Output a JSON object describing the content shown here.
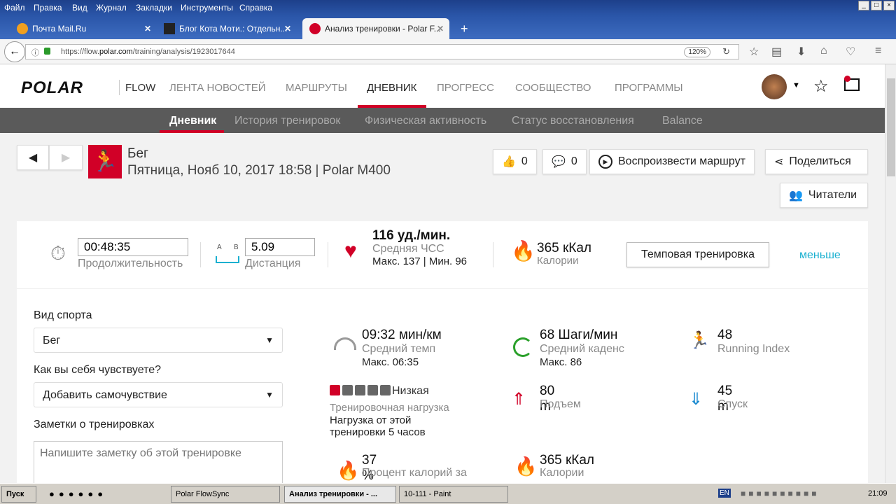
{
  "browser": {
    "menu": [
      "Файл",
      "Правка",
      "Вид",
      "Журнал",
      "Закладки",
      "Инструменты",
      "Справка"
    ],
    "tabs": [
      {
        "title": "Почта Mail.Ru"
      },
      {
        "title": "Блог Кота Моти.: Отдельн..."
      },
      {
        "title": "Анализ тренировки - Polar F..."
      }
    ],
    "url_prefix": "https://flow.",
    "url_domain": "polar.com",
    "url_path": "/training/analysis/1923017644",
    "zoom": "120%"
  },
  "header": {
    "logo": "POLAR",
    "flow": "FLOW",
    "nav": [
      "ЛЕНТА НОВОСТЕЙ",
      "МАРШРУТЫ",
      "ДНЕВНИК",
      "ПРОГРЕСС",
      "СООБЩЕСТВО",
      "ПРОГРАММЫ"
    ],
    "active": "ДНЕВНИК"
  },
  "subnav": [
    "Дневник",
    "История тренировок",
    "Физическая активность",
    "Статус восстановления",
    "Balance"
  ],
  "training": {
    "sport": "Бег",
    "datetime": "Пятница, Нояб 10, 2017 18:58 | Polar M400",
    "likes": "0",
    "comments": "0",
    "play_route": "Воспроизвести маршрут",
    "share": "Поделиться",
    "followers": "Читатели"
  },
  "summary": {
    "duration": "00:48:35",
    "duration_label": "Продолжительность",
    "dist_a": "A",
    "dist_b": "B",
    "distance": "5.09",
    "distance_label": "Дистанция",
    "hr": "116 уд./мин.",
    "hr_label": "Средняя ЧСС",
    "hr_minmax": "Макс. 137  |  Мин. 96",
    "calories": "365 кКал",
    "calories_label": "Калории",
    "tempo_button": "Темповая тренировка",
    "less": "меньше"
  },
  "form": {
    "sport_label": "Вид спорта",
    "sport_value": "Бег",
    "feeling_label": "Как вы себя чувствуете?",
    "feeling_value": "Добавить самочувствие",
    "notes_label": "Заметки о тренировках",
    "notes_placeholder": "Напишите заметку об этой тренировке"
  },
  "metrics": {
    "pace": {
      "value": "09:32 мин/км",
      "label": "Средний темп",
      "extra": "Макс. 06:35"
    },
    "cadence": {
      "value": "68 Шаги/мин",
      "label": "Средний каденс",
      "extra": "Макс. 86"
    },
    "running_index": {
      "value": "48",
      "label": "Running Index"
    },
    "load": {
      "level": "Низкая",
      "level_filled": 1,
      "level_total": 5,
      "label": "Тренировочная нагрузка",
      "extra": "Нагрузка от этой тренировки 5 часов"
    },
    "ascent": {
      "value": "80 m",
      "label": "Подъем"
    },
    "descent": {
      "value": "45 m",
      "label": "Спуск"
    },
    "fat_pct": {
      "value": "37 %",
      "label": "Процент калорий за"
    },
    "calories": {
      "value": "365 кКал",
      "label": "Калории"
    }
  },
  "taskbar": {
    "start": "Пуск",
    "items": [
      "Polar FlowSync",
      "Анализ тренировки - ...",
      "10-111 - Paint"
    ],
    "lang": "EN",
    "time": "21:09"
  },
  "colors": {
    "accent": "#d10027",
    "link": "#1ab0d0",
    "subnav": "#5a5a5a"
  }
}
